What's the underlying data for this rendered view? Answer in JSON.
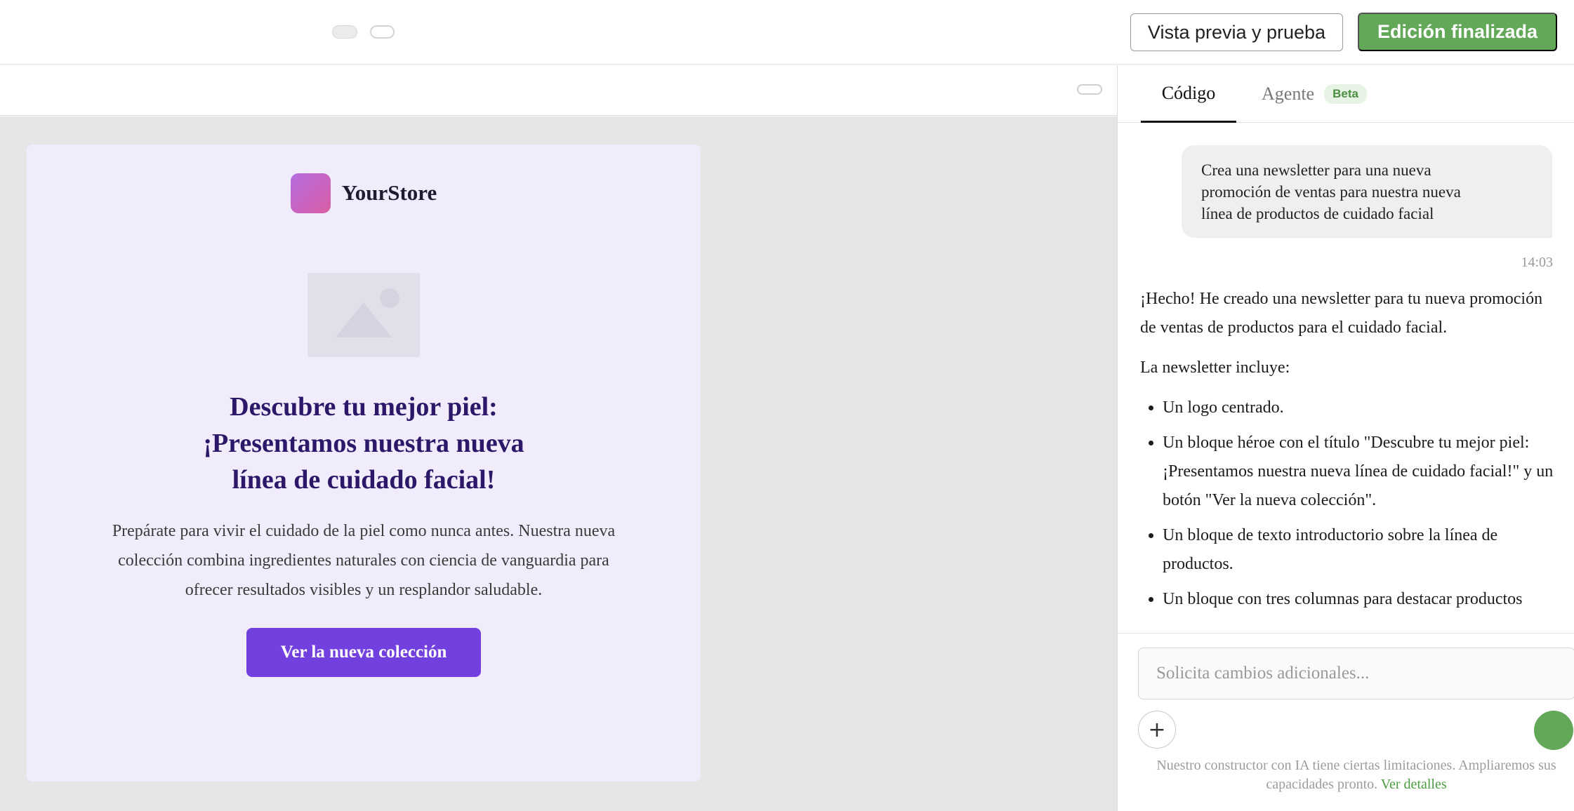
{
  "topbar": {
    "preview_label": "Vista previa y prueba",
    "done_label": "Edición finalizada"
  },
  "email": {
    "brand": "YourStore",
    "headline_lines": [
      "Descubre tu mejor piel:",
      "¡Presentamos nuestra nueva",
      "línea de cuidado facial!"
    ],
    "intro_lines": [
      "Prepárate para vivir el cuidado de la piel como nunca antes. Nuestra nueva",
      "colección combina ingredientes naturales con ciencia de vanguardia para",
      "ofrecer resultados visibles y un resplandor saludable."
    ],
    "cta_label": "Ver la nueva colección"
  },
  "panel": {
    "tabs": [
      {
        "label": "Código",
        "active": true
      },
      {
        "label": "Agente",
        "badge": "Beta"
      }
    ],
    "messages": {
      "user_lines": [
        "Crea una newsletter para una nueva",
        "promoción de ventas para nuestra nueva",
        "línea de productos de cuidado facial"
      ],
      "time": "14:03",
      "reply_intro": "¡Hecho! He creado una newsletter para tu nueva promoción de ventas de productos para el cuidado facial.",
      "reply_list_title": "La newsletter incluye:",
      "reply_items": [
        "Un logo centrado.",
        "Un bloque héroe con el título \"Descubre tu mejor piel: ¡Presentamos nuestra nueva línea de cuidado facial!\" y un botón \"Ver la nueva colección\".",
        "Un bloque de texto introductorio sobre la línea de productos.",
        "Un bloque con tres columnas para destacar productos"
      ]
    },
    "composer": {
      "placeholder": "Solicita cambios adicionales...",
      "plus_icon": "plus-icon",
      "send_icon": "send-icon"
    },
    "footnote": "Nuestro constructor con IA tiene ciertas limitaciones. Ampliaremos sus capacidades pronto.",
    "footnote_link": "Ver detalles"
  },
  "colors": {
    "accent_green": "#63a858",
    "brand_purple": "#7340e0",
    "headline_purple": "#2d1769",
    "email_bg": "#f1ecfb"
  }
}
